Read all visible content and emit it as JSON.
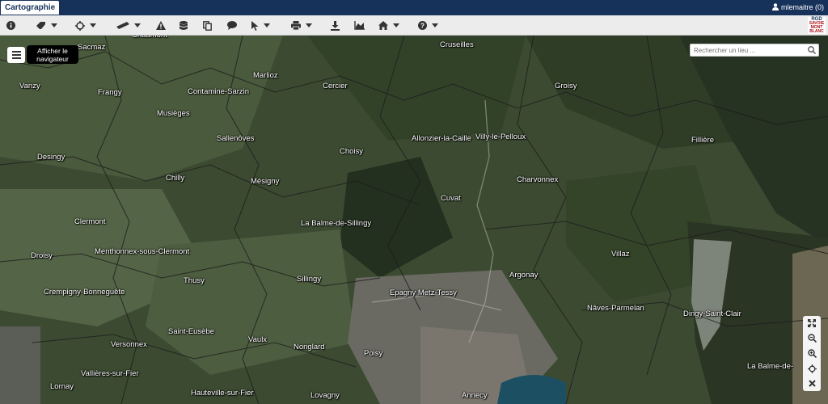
{
  "tab": {
    "label": "Cartographie"
  },
  "user": {
    "label": "mlemaitre (0)"
  },
  "toolbar": {
    "tools": [
      "info-icon",
      "eraser-icon",
      "crosshair-icon",
      "ruler-icon",
      "warning-icon",
      "database-icon",
      "copy-icon",
      "comment-icon",
      "pointer-icon",
      "print-icon",
      "download-icon",
      "area-chart-icon",
      "home-icon",
      "help-icon"
    ]
  },
  "logo": {
    "line1": "RGD",
    "line2": "SAVOIE",
    "line3": "MONT",
    "line4": "BLANC"
  },
  "navigator": {
    "tooltip_line1": "Afficher le",
    "tooltip_line2": "navigateur"
  },
  "search": {
    "placeholder": "Rechercher un lieu ..."
  },
  "map_controls": [
    "fullscreen-icon",
    "zoom-out-icon",
    "zoom-in-icon",
    "locate-icon",
    "close-icon"
  ],
  "places": [
    {
      "name": "Chaumont"
    },
    {
      "name": "Vanzy"
    },
    {
      "name": "Frangy"
    },
    {
      "name": "Contamine-Sarzin"
    },
    {
      "name": "Marlioz"
    },
    {
      "name": "Cercier"
    },
    {
      "name": "Cruseilles"
    },
    {
      "name": "Groisy"
    },
    {
      "name": "Musièges"
    },
    {
      "name": "Sallenôves"
    },
    {
      "name": "Allonzier-la-Caille"
    },
    {
      "name": "Villy-le-Pelloux"
    },
    {
      "name": "Desingy"
    },
    {
      "name": "Choisy"
    },
    {
      "name": "Fillière"
    },
    {
      "name": "Chilly"
    },
    {
      "name": "Mésigny"
    },
    {
      "name": "Charvonnex"
    },
    {
      "name": "Cuvat"
    },
    {
      "name": "Clermont"
    },
    {
      "name": "La Balme-de-Sillingy"
    },
    {
      "name": "Menthonnex-sous-Clermont"
    },
    {
      "name": "Droisy"
    },
    {
      "name": "Villaz"
    },
    {
      "name": "Argonay"
    },
    {
      "name": "Sillingy"
    },
    {
      "name": "Thusy"
    },
    {
      "name": "Epagny Metz-Tessy"
    },
    {
      "name": "Vaulx"
    },
    {
      "name": "Crempigny-Bonneguête"
    },
    {
      "name": "Nâves-Parmelan"
    },
    {
      "name": "Dingy-Saint-Clair"
    },
    {
      "name": "Saint-Eusèbe"
    },
    {
      "name": "Versonnex"
    },
    {
      "name": "Nonglard"
    },
    {
      "name": "Poisy"
    },
    {
      "name": "Vallières-sur-Fier"
    },
    {
      "name": "La Balme-de-"
    },
    {
      "name": "Lornay"
    },
    {
      "name": "Lovagny"
    },
    {
      "name": "Hauteville-sur-Fier"
    },
    {
      "name": "Annecy"
    },
    {
      "name": "Sacmaz"
    }
  ]
}
